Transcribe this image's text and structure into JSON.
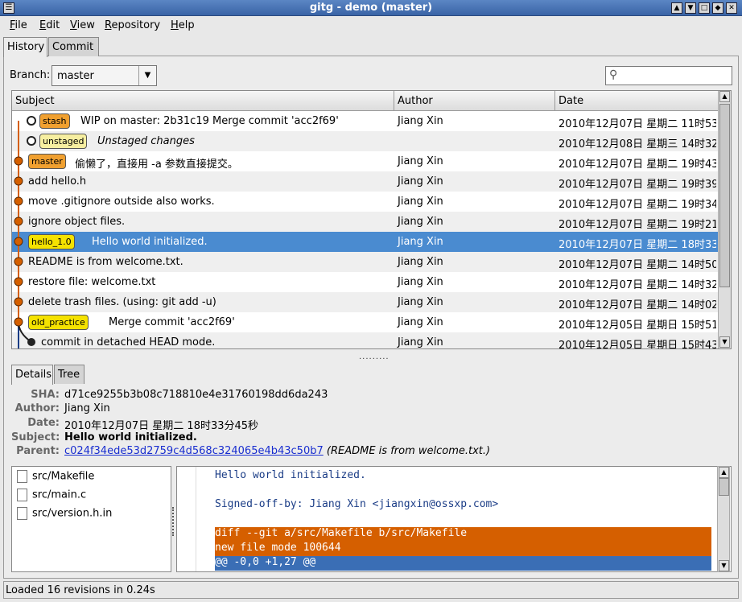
{
  "window": {
    "title": "gitg - demo (master)"
  },
  "menu": {
    "file": "File",
    "edit": "Edit",
    "view": "View",
    "repository": "Repository",
    "help": "Help"
  },
  "tabs": {
    "history": "History",
    "commit": "Commit"
  },
  "branch": {
    "label": "Branch:",
    "value": "master"
  },
  "search": {
    "placeholder": ""
  },
  "columns": {
    "subject": "Subject",
    "author": "Author",
    "date": "Date"
  },
  "rows": [
    {
      "tag": "stash",
      "tag_color": "orange",
      "subject": "WIP on master: 2b31c19 Merge commit 'acc2f69'",
      "author": "Jiang Xin",
      "date": "2010年12月07日 星期二 11时53"
    },
    {
      "tag": "unstaged",
      "tag_color": "pale",
      "subject": "Unstaged changes",
      "author": "",
      "date": "2010年12月08日 星期三 14时32"
    },
    {
      "tag": "master",
      "tag_color": "orange",
      "subject": "偷懒了，直接用 -a 参数直接提交。",
      "author": "Jiang Xin",
      "date": "2010年12月07日 星期二 19时43"
    },
    {
      "tag": "",
      "subject": "add hello.h",
      "author": "Jiang Xin",
      "date": "2010年12月07日 星期二 19时39"
    },
    {
      "tag": "",
      "subject": "move .gitignore outside also works.",
      "author": "Jiang Xin",
      "date": "2010年12月07日 星期二 19时34"
    },
    {
      "tag": "",
      "subject": "ignore object files.",
      "author": "Jiang Xin",
      "date": "2010年12月07日 星期二 19时21"
    },
    {
      "tag": "hello_1.0",
      "tag_color": "yellow",
      "subject": "Hello world initialized.",
      "author": "Jiang Xin",
      "date": "2010年12月07日 星期二 18时33"
    },
    {
      "tag": "",
      "subject": "README is from welcome.txt.",
      "author": "Jiang Xin",
      "date": "2010年12月07日 星期二 14时50"
    },
    {
      "tag": "",
      "subject": "restore file: welcome.txt",
      "author": "Jiang Xin",
      "date": "2010年12月07日 星期二 14时32"
    },
    {
      "tag": "",
      "subject": "delete trash files. (using: git add -u)",
      "author": "Jiang Xin",
      "date": "2010年12月07日 星期二 14时02"
    },
    {
      "tag": "old_practice",
      "tag_color": "yellow",
      "subject": "Merge commit 'acc2f69'",
      "author": "Jiang Xin",
      "date": "2010年12月05日 星期日 15时51"
    },
    {
      "tag": "",
      "subject": "commit in detached HEAD mode.",
      "author": "Jiang Xin",
      "date": "2010年12月05日 星期日 15时43"
    }
  ],
  "detail_tabs": {
    "details": "Details",
    "tree": "Tree"
  },
  "details": {
    "sha_label": "SHA:",
    "sha": "d71ce9255b3b08c718810e4e31760198dd6da243",
    "author_label": "Author:",
    "author": "Jiang Xin",
    "date_label": "Date:",
    "date": "2010年12月07日 星期二 18时33分45秒",
    "subject_label": "Subject:",
    "subject": "Hello world initialized.",
    "parent_label": "Parent:",
    "parent": "c024f34ede53d2759c4d568c324065e4b43c50b7",
    "parent_note": "(README is from welcome.txt.)"
  },
  "files": [
    "src/Makefile",
    "src/main.c",
    "src/version.h.in"
  ],
  "diff": {
    "line1": "Hello world initialized.",
    "line2": "Signed-off-by: Jiang Xin <jiangxin@ossxp.com>",
    "line3": "diff --git a/src/Makefile b/src/Makefile",
    "line4": "new file mode 100644",
    "line5": "@@ -0,0 +1,27 @@"
  },
  "status": "Loaded 16 revisions in 0.24s",
  "colors": {
    "title_bar": "#4a74b8",
    "selection": "#4a8bd0",
    "graph_node": "#d55f00",
    "diff_header": "#d55f00",
    "diff_hunk": "#3a6eb5"
  }
}
